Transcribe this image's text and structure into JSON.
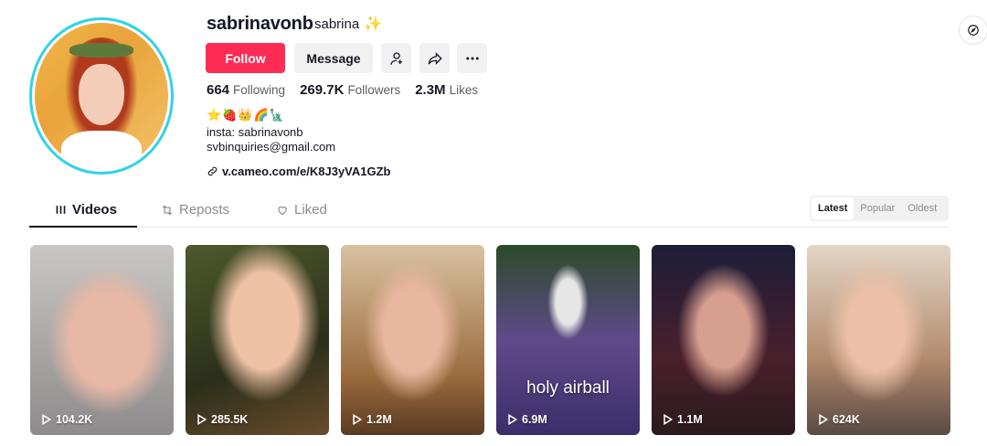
{
  "profile": {
    "username": "sabrinavonb",
    "nickname": "sabrina",
    "nickname_badge": "✨",
    "follow_label": "Follow",
    "message_label": "Message",
    "stats": {
      "following_count": "664",
      "following_label": "Following",
      "followers_count": "269.7K",
      "followers_label": "Followers",
      "likes_count": "2.3M",
      "likes_label": "Likes"
    },
    "bio_emojis": "⭐🍓👑🌈🗽",
    "bio_line1": "insta: sabrinavonb",
    "bio_line2": "svbinquiries@gmail.com",
    "link": "v.cameo.com/e/K8J3yVA1GZb"
  },
  "tabs": [
    {
      "label": "Videos"
    },
    {
      "label": "Reposts"
    },
    {
      "label": "Liked"
    }
  ],
  "sort_options": [
    "Latest",
    "Popular",
    "Oldest"
  ],
  "videos": [
    {
      "views": "104.2K",
      "caption": ""
    },
    {
      "views": "285.5K",
      "caption": ""
    },
    {
      "views": "1.2M",
      "caption": ""
    },
    {
      "views": "6.9M",
      "caption": "holy airball"
    },
    {
      "views": "1.1M",
      "caption": ""
    },
    {
      "views": "624K",
      "caption": ""
    }
  ],
  "colors": {
    "accent": "#fe2c55",
    "avatar_ring": "#2fd3e6",
    "text": "#161823",
    "muted": "#8a8b91"
  }
}
